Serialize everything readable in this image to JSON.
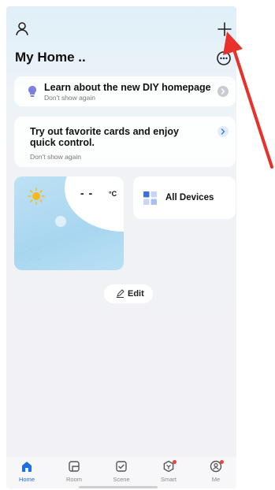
{
  "header": {
    "home_title": "My Home ..",
    "icons": [
      "user-icon",
      "plus-icon",
      "more-icon"
    ]
  },
  "banners": [
    {
      "title": "Learn about the new DIY homepage",
      "subtitle": "Don't show again",
      "icon": "bulb-icon"
    },
    {
      "title": "Try out favorite cards and enjoy quick control.",
      "subtitle": "Don't show again"
    }
  ],
  "weather": {
    "temperature": "- -",
    "unit": "°C",
    "placeholder_1": "- -",
    "placeholder_2": "- -",
    "icon": "sun-icon"
  },
  "devices_card": {
    "label": "All Devices",
    "icon": "grid-icon"
  },
  "edit_button": {
    "label": "Edit",
    "icon": "pencil-icon"
  },
  "tabbar": {
    "items": [
      {
        "label": "Home",
        "icon": "home-icon",
        "active": true
      },
      {
        "label": "Room",
        "icon": "room-icon"
      },
      {
        "label": "Scene",
        "icon": "scene-icon"
      },
      {
        "label": "Smart",
        "icon": "smart-icon",
        "badge": true
      },
      {
        "label": "Me",
        "icon": "me-icon",
        "badge": true
      }
    ]
  },
  "colors": {
    "accent": "#1e6fe0",
    "annotation_arrow": "#e8312a",
    "badge": "#e8453c"
  }
}
